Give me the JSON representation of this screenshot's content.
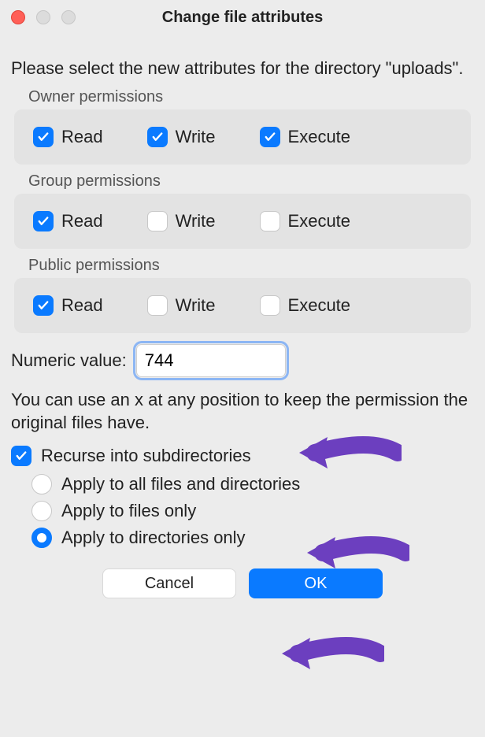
{
  "window": {
    "title": "Change file attributes"
  },
  "intro": "Please select the new attributes for the directory \"uploads\".",
  "permissions": {
    "owner": {
      "legend": "Owner permissions",
      "read": {
        "label": "Read",
        "checked": true
      },
      "write": {
        "label": "Write",
        "checked": true
      },
      "exec": {
        "label": "Execute",
        "checked": true
      }
    },
    "group": {
      "legend": "Group permissions",
      "read": {
        "label": "Read",
        "checked": true
      },
      "write": {
        "label": "Write",
        "checked": false
      },
      "exec": {
        "label": "Execute",
        "checked": false
      }
    },
    "public": {
      "legend": "Public permissions",
      "read": {
        "label": "Read",
        "checked": true
      },
      "write": {
        "label": "Write",
        "checked": false
      },
      "exec": {
        "label": "Execute",
        "checked": false
      }
    }
  },
  "numeric": {
    "label": "Numeric value:",
    "value": "744"
  },
  "help": "You can use an x at any position to keep the permission the original files have.",
  "recurse": {
    "label": "Recurse into subdirectories",
    "checked": true,
    "options": {
      "all": {
        "label": "Apply to all files and directories",
        "selected": false
      },
      "files": {
        "label": "Apply to files only",
        "selected": false
      },
      "dirs": {
        "label": "Apply to directories only",
        "selected": true
      }
    }
  },
  "buttons": {
    "cancel": "Cancel",
    "ok": "OK"
  },
  "annotation_color": "#6c3fbf"
}
